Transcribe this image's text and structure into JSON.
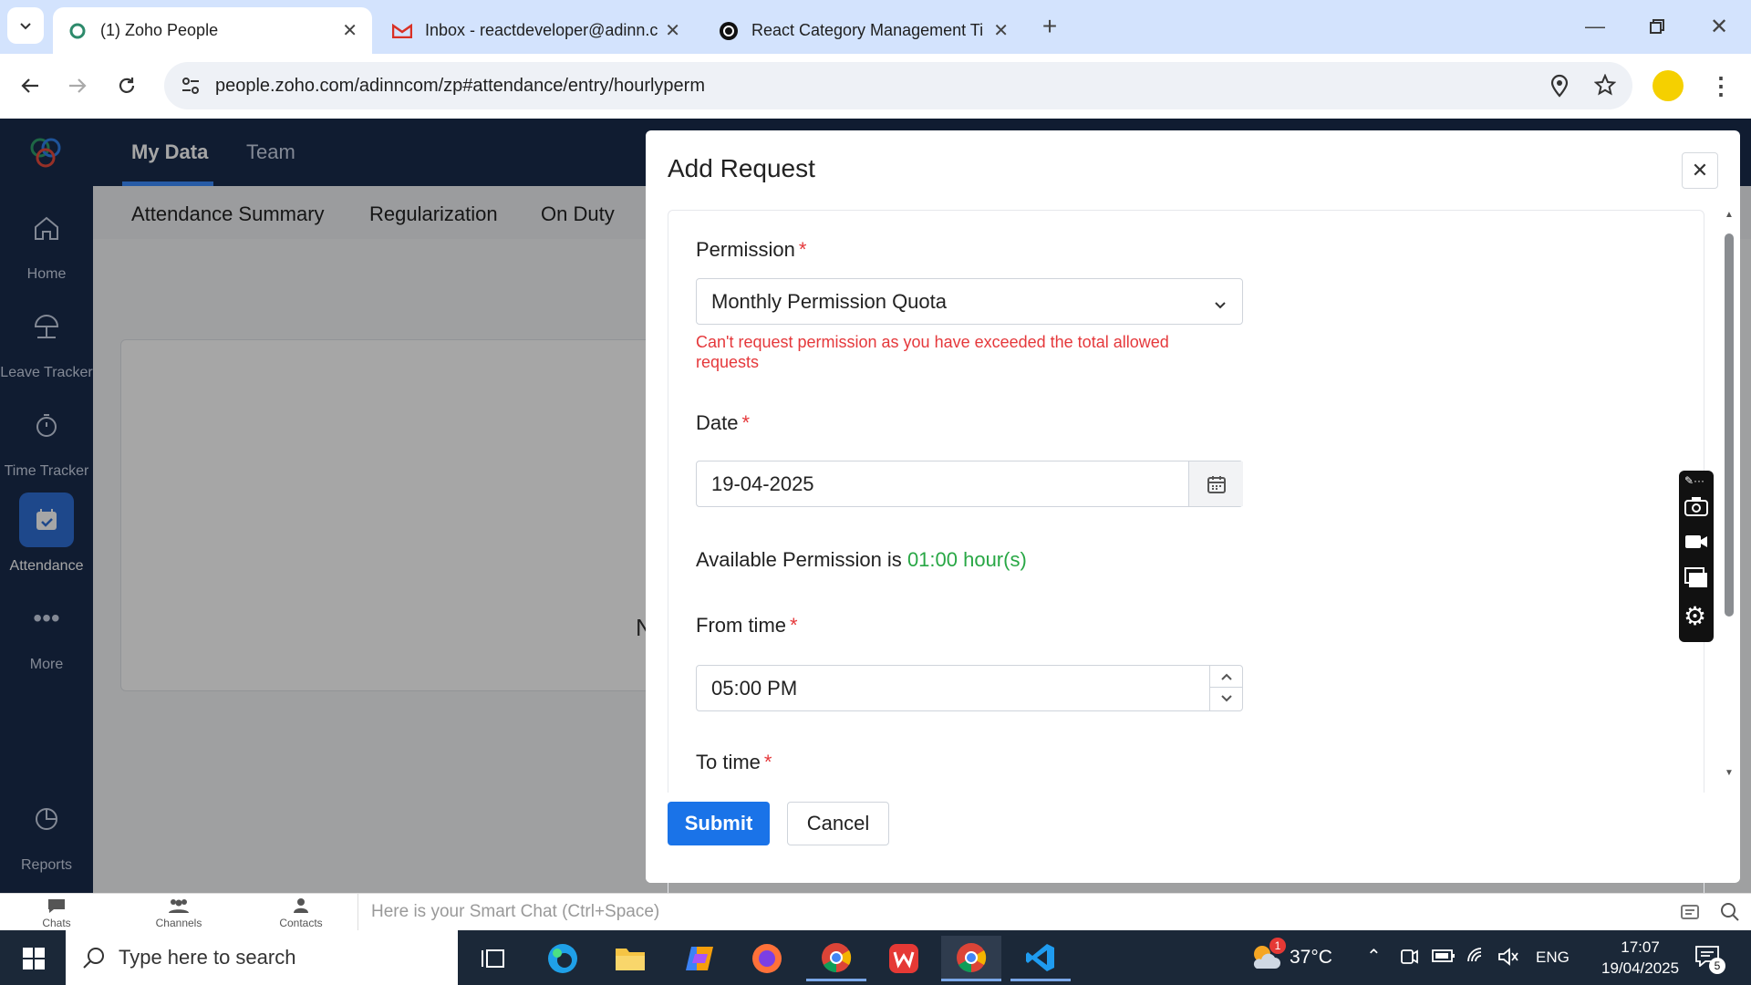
{
  "browser": {
    "tabs": [
      {
        "label": "(1) Zoho People"
      },
      {
        "label": "Inbox - reactdeveloper@adinn.c"
      },
      {
        "label": "React Category Management Ti"
      }
    ],
    "url": "people.zoho.com/adinncom/zp#attendance/entry/hourlyperm"
  },
  "topnav": {
    "items": [
      "My Data",
      "Team"
    ]
  },
  "subnav": {
    "items": [
      "Attendance Summary",
      "Regularization",
      "On Duty"
    ]
  },
  "sidebar": {
    "items": [
      {
        "label": "Home",
        "icon": "home-icon"
      },
      {
        "label": "Leave Tracker",
        "icon": "beach-umbrella-icon"
      },
      {
        "label": "Time Tracker",
        "icon": "stopwatch-icon"
      },
      {
        "label": "Attendance",
        "icon": "calendar-check-icon"
      },
      {
        "label": "More",
        "icon": "more-dots-icon"
      },
      {
        "label": "Reports",
        "icon": "pie-chart-icon"
      }
    ]
  },
  "background_text": "N",
  "modal": {
    "title": "Add Request",
    "permission_label": "Permission",
    "permission_value": "Monthly Permission Quota",
    "permission_error": "Can't request permission as you have exceeded the total allowed requests",
    "date_label": "Date",
    "date_value": "19-04-2025",
    "available_prefix": "Available Permission is",
    "available_value": "01:00 hour(s)",
    "from_label": "From time",
    "from_value": "05:00 PM",
    "to_label": "To time",
    "required_mark": "*",
    "submit_label": "Submit",
    "cancel_label": "Cancel"
  },
  "smartchat": {
    "items": [
      "Chats",
      "Channels",
      "Contacts"
    ],
    "placeholder": "Here is your Smart Chat (Ctrl+Space)"
  },
  "taskbar": {
    "search_placeholder": "Type here to search",
    "weather_badge": "1",
    "temperature": "37°C",
    "language": "ENG",
    "time": "17:07",
    "date": "19/04/2025",
    "notification_count": "5"
  },
  "colors": {
    "accent": "#1a73e8",
    "error": "#e5383b",
    "available": "#28a745",
    "sidebar_bg": "#1a2b4c"
  }
}
